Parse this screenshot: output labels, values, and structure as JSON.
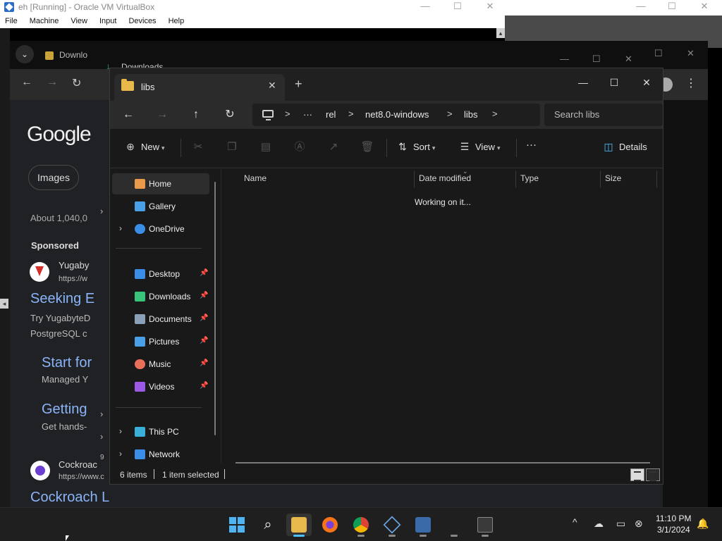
{
  "host": {
    "title": "eh [Running] - Oracle VM VirtualBox",
    "menu": [
      "File",
      "Machine",
      "View",
      "Input",
      "Devices",
      "Help"
    ],
    "minimize": "—",
    "maximize": "☐",
    "close": "✕"
  },
  "chrome": {
    "tab_dropdown": "⌄",
    "tab1_title": "Downlo",
    "tab2_title": "Downloads",
    "nav_back": "←",
    "nav_forward": "→",
    "nav_reload": "↻",
    "kebab": "⋮",
    "google_logo": "Google",
    "images_chip": "Images",
    "about": "About 1,040,0",
    "sponsored": "Sponsored",
    "ads": [
      {
        "name": "Yugaby",
        "url": "https://w",
        "headline": "Seeking E",
        "text1": "Try YugabyteD",
        "text2": "PostgreSQL c"
      },
      {
        "headline": "Start for",
        "text1": "Managed Y"
      },
      {
        "headline": "Getting",
        "text1": "Get hands-"
      },
      {
        "name": "Cockroac",
        "url": "https://www.c",
        "headline": "Cockroach L"
      }
    ],
    "side_digit": "9"
  },
  "explorer": {
    "tab_title": "libs",
    "tab_close": "✕",
    "new_tab": "+",
    "win_min": "—",
    "win_max": "☐",
    "win_close": "✕",
    "nav": {
      "back": "←",
      "forward": "→",
      "up": "↑",
      "refresh": "↻"
    },
    "breadcrumb": {
      "more": "···",
      "items": [
        "rel",
        "net8.0-windows",
        "libs"
      ],
      "sep": ">"
    },
    "search_placeholder": "Search libs",
    "commands": {
      "new": "New",
      "sort": "Sort",
      "view": "View",
      "more": "···",
      "details": "Details"
    },
    "sidebar": {
      "home": "Home",
      "gallery": "Gallery",
      "onedrive": "OneDrive",
      "quick": [
        {
          "label": "Desktop",
          "color": "#3a8ee6"
        },
        {
          "label": "Downloads",
          "color": "#3ac37a"
        },
        {
          "label": "Documents",
          "color": "#8aa0b8"
        },
        {
          "label": "Pictures",
          "color": "#4aa0e6"
        },
        {
          "label": "Music",
          "color": "#e8705a"
        },
        {
          "label": "Videos",
          "color": "#9a5ae6"
        }
      ],
      "this_pc": "This PC",
      "network": "Network"
    },
    "columns": [
      "Name",
      "Date modified",
      "Type",
      "Size"
    ],
    "status_message": "Working on it...",
    "status": {
      "items": "6 items",
      "selected": "1 item selected"
    }
  },
  "taskbar": {
    "search_glyph": "⌕",
    "tray_up": "^",
    "time": "11:10 PM",
    "date": "3/1/2024"
  }
}
